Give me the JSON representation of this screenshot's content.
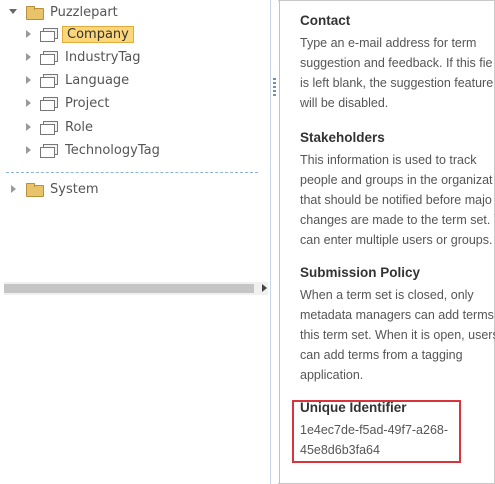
{
  "tree": {
    "root": {
      "label": "Puzzlepart",
      "icon": "folder-icon"
    },
    "children": [
      {
        "label": "Company",
        "icon": "termset-icon",
        "selected": true
      },
      {
        "label": "IndustryTag",
        "icon": "termset-icon"
      },
      {
        "label": "Language",
        "icon": "termset-icon"
      },
      {
        "label": "Project",
        "icon": "termset-icon"
      },
      {
        "label": "Role",
        "icon": "termset-icon"
      },
      {
        "label": "TechnologyTag",
        "icon": "termset-icon"
      }
    ],
    "system": {
      "label": "System",
      "icon": "folder-icon"
    }
  },
  "details": {
    "contact": {
      "title": "Contact",
      "lines": [
        "Type an e-mail address for term",
        "suggestion and feedback. If this fie",
        "is left blank, the suggestion feature",
        "will be disabled."
      ]
    },
    "stakeholders": {
      "title": "Stakeholders",
      "lines": [
        "This information is used to track",
        "people and groups in the organizat",
        "that should be notified before majo",
        "changes are made to the term set. `",
        "can enter multiple users or groups."
      ]
    },
    "submission": {
      "title": "Submission Policy",
      "lines": [
        "When a term set is closed, only",
        "metadata managers can add terms",
        "this term set. When it is open, users",
        "can add terms from a tagging",
        "application."
      ]
    },
    "unique_identifier": {
      "title": "Unique Identifier",
      "value_lines": [
        "1e4ec7de-f5ad-49f7-a268-",
        "45e8d6b3fa64"
      ]
    }
  },
  "colors": {
    "selection_fill": "#fbd779",
    "selection_border": "#e2ac3b",
    "highlight_box": "#d9333c",
    "folder": "#e8c36a"
  }
}
